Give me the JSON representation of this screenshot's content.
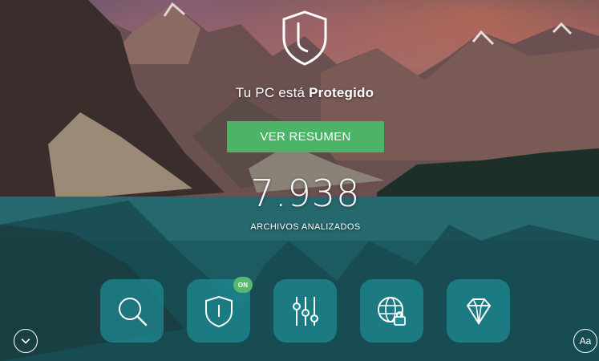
{
  "status": {
    "prefix": "Tu PC está",
    "state": "Protegido"
  },
  "summary_button": "VER RESUMEN",
  "scan": {
    "count": "7.938",
    "label": "ARCHIVOS ANALIZADOS"
  },
  "tiles": [
    {
      "icon": "search-icon",
      "name": "scan"
    },
    {
      "icon": "shield-icon",
      "name": "protection",
      "badge": "ON"
    },
    {
      "icon": "sliders-icon",
      "name": "settings"
    },
    {
      "icon": "globe-lock-icon",
      "name": "web-protection"
    },
    {
      "icon": "diamond-icon",
      "name": "premium"
    }
  ],
  "font_button": "Aa",
  "colors": {
    "accent_green": "#4cb467",
    "tile": "#1e8c96"
  }
}
